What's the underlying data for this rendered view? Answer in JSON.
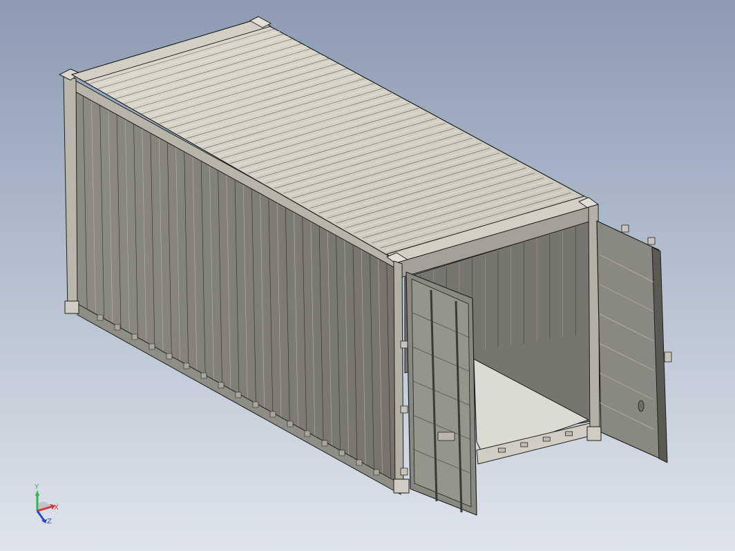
{
  "viewport": {
    "background_top": "#8c9bb3",
    "background_bottom": "#dfe4ec",
    "model": "shipping-container-20ft",
    "view": "isometric",
    "display_style": "shaded-with-edges"
  },
  "model_colors": {
    "roof_light": "#d6d3c7",
    "roof_shade": "#a9a79e",
    "side_light": "#9c9b92",
    "side_dark": "#6e6d66",
    "frame": "#c9c7bc",
    "floor": "#dcdbd3",
    "interior": "#7a7a72",
    "edge": "#1e1e1e"
  },
  "triad": {
    "x_label": "X",
    "y_label": "Y",
    "z_label": "Z",
    "x_color": "#d23a3a",
    "y_color": "#32b24a",
    "z_color": "#2b46c8"
  }
}
